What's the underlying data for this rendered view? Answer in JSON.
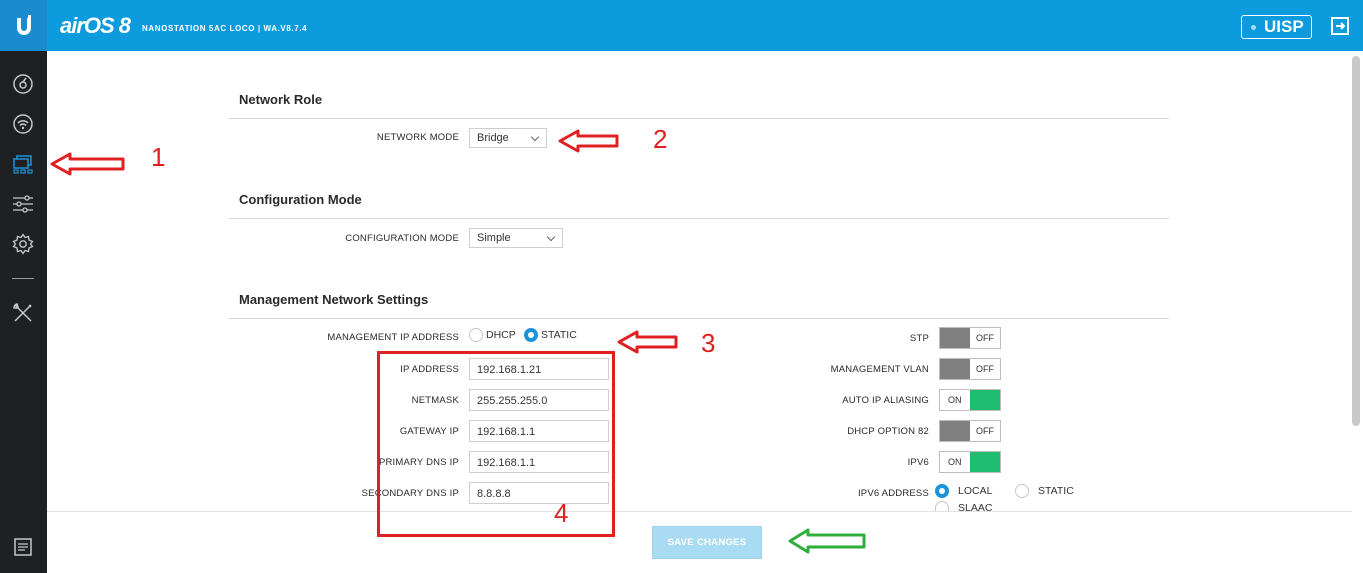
{
  "header": {
    "brand": "airOS 8",
    "device": "NANOSTATION 5AC LOCO | WA.V8.7.4",
    "uisp_label": "UISP",
    "colors": {
      "bar": "#0c9bdc",
      "sidebar": "#1f2024"
    }
  },
  "sidebar": {
    "items": [
      {
        "icon": "dashboard-icon"
      },
      {
        "icon": "wireless-icon"
      },
      {
        "icon": "network-icon",
        "active": true
      },
      {
        "icon": "services-icon"
      },
      {
        "icon": "settings-icon"
      },
      {
        "icon": "tools-icon"
      },
      {
        "icon": "log-icon"
      }
    ]
  },
  "network_role": {
    "title": "Network Role",
    "mode_label": "NETWORK MODE",
    "mode_value": "Bridge"
  },
  "configuration_mode": {
    "title": "Configuration Mode",
    "label": "CONFIGURATION MODE",
    "value": "Simple"
  },
  "management": {
    "title": "Management Network Settings",
    "ip_address_label": "MANAGEMENT IP ADDRESS",
    "dhcp_label": "DHCP",
    "static_label": "STATIC",
    "selected": "STATIC",
    "fields": {
      "ip_address": {
        "label": "IP ADDRESS",
        "value": "192.168.1.21"
      },
      "netmask": {
        "label": "NETMASK",
        "value": "255.255.255.0"
      },
      "gateway": {
        "label": "GATEWAY IP",
        "value": "192.168.1.1"
      },
      "primary_dns": {
        "label": "PRIMARY DNS IP",
        "value": "192.168.1.1"
      },
      "secondary_dns": {
        "label": "SECONDARY DNS IP",
        "value": "8.8.8.8"
      }
    },
    "toggles": {
      "stp": {
        "label": "STP",
        "state": "OFF"
      },
      "management_vlan": {
        "label": "MANAGEMENT VLAN",
        "state": "OFF"
      },
      "auto_ip_aliasing": {
        "label": "AUTO IP ALIASING",
        "state": "ON"
      },
      "dhcp_option_82": {
        "label": "DHCP OPTION 82",
        "state": "OFF"
      },
      "ipv6": {
        "label": "IPV6",
        "state": "ON"
      }
    },
    "ipv6_address": {
      "label": "IPV6 ADDRESS",
      "local": "LOCAL",
      "static": "STATIC",
      "slaac": "SLAAC",
      "selected": "LOCAL"
    }
  },
  "actions": {
    "save_label": "SAVE CHANGES"
  },
  "annotations": {
    "n1": "1",
    "n2": "2",
    "n3": "3",
    "n4": "4"
  }
}
